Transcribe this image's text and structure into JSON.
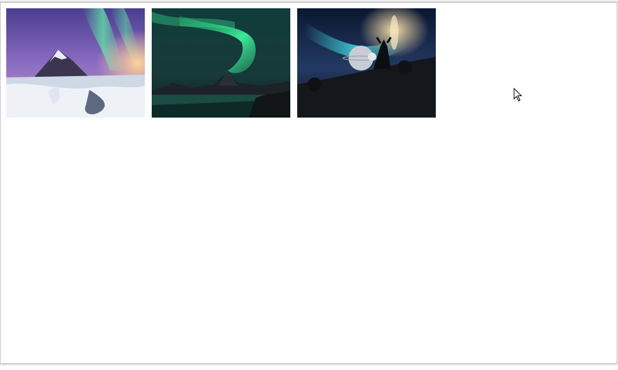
{
  "gallery": {
    "images": [
      {
        "name": "aurora-mountain-snow",
        "colors": {
          "sky_top": "#5a4a9e",
          "sky_mid": "#7a5fb8",
          "aurora": "#5fe0a6",
          "glow": "#f2a86b",
          "snow": "#e9eef5",
          "water": "#6c7d92"
        }
      },
      {
        "name": "aurora-green-lake",
        "colors": {
          "sky_top": "#0e2a2e",
          "sky_mid": "#1f4a44",
          "aurora": "#3df29a",
          "mountain": "#1a2023",
          "water": "#1d4b43"
        }
      },
      {
        "name": "aurora-planets-fantasy",
        "colors": {
          "sky_top": "#0b1730",
          "sky_mid": "#1d3a66",
          "aurora": "#3fd0d8",
          "glow": "#f4d9a6",
          "ground": "#121416",
          "planet": "#cfd3db"
        }
      }
    ]
  },
  "cursor": {
    "icon": "arrow-cursor-icon"
  }
}
